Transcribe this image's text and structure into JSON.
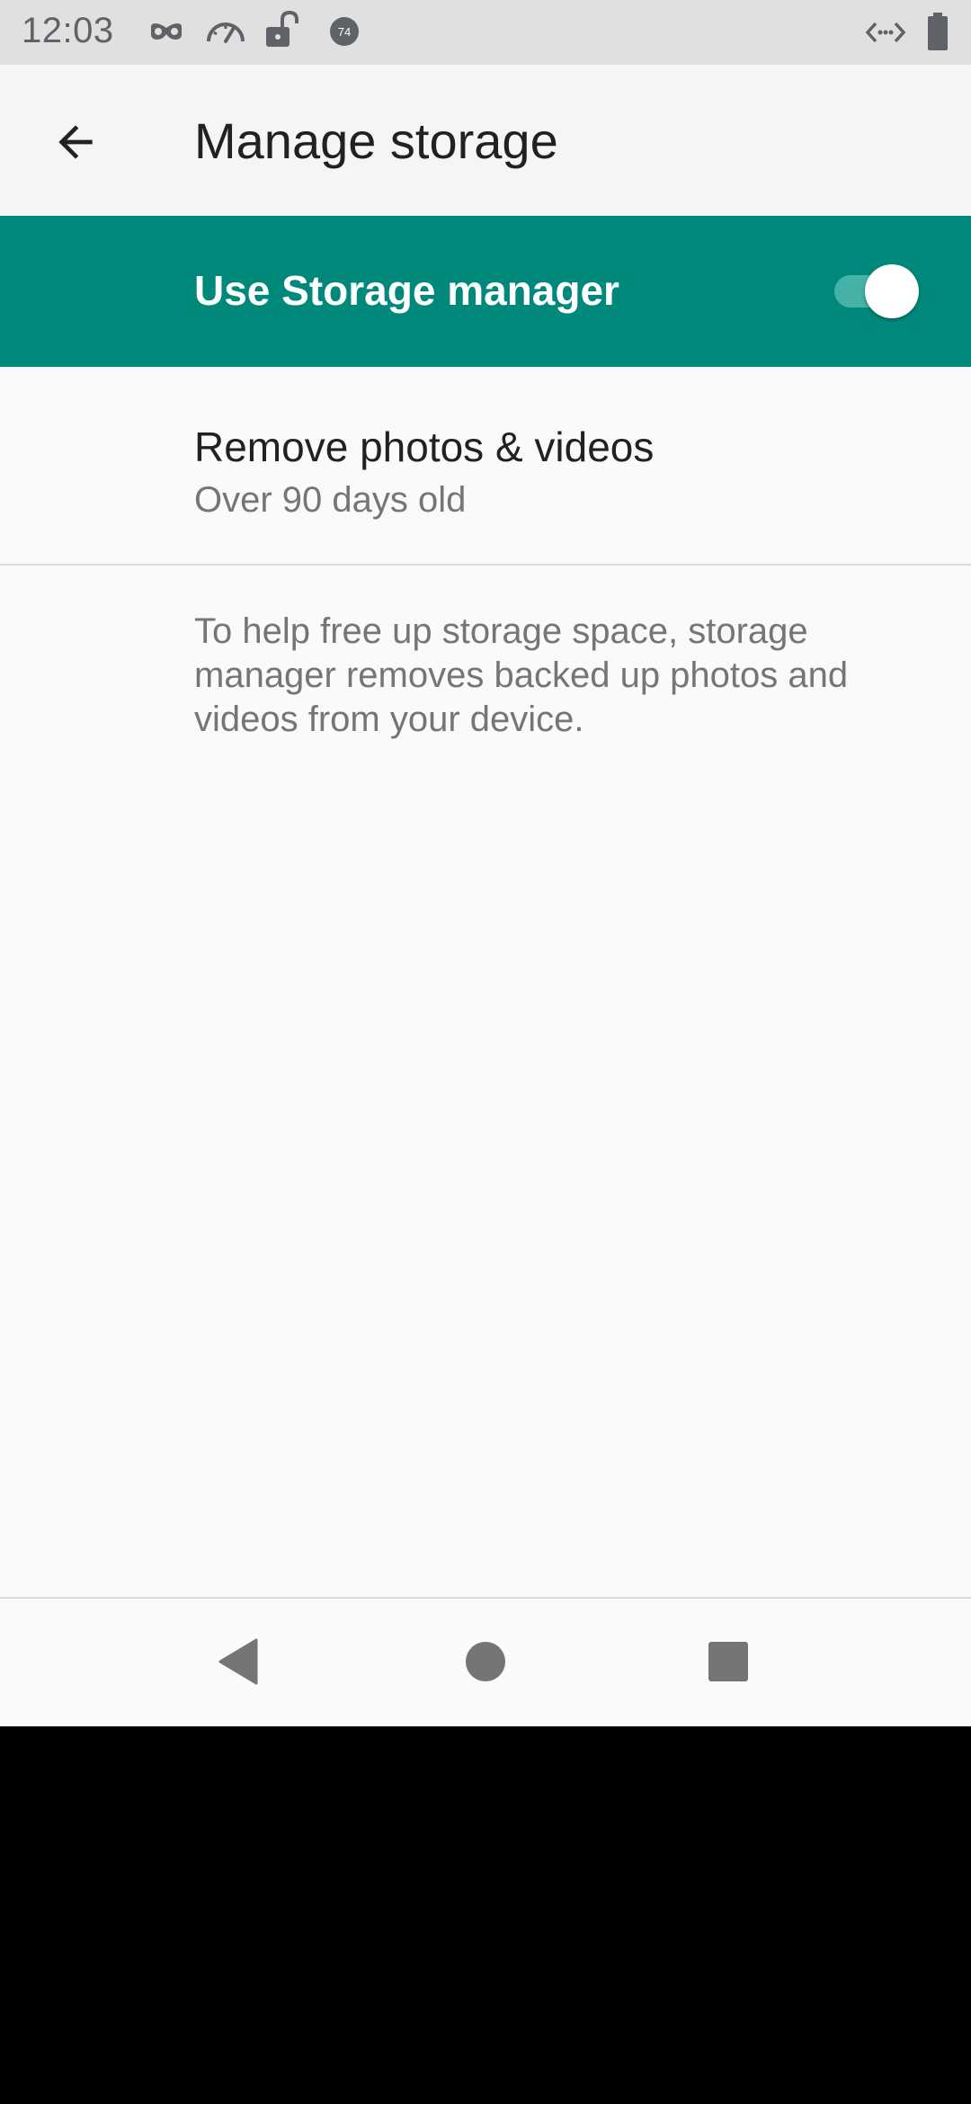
{
  "status_bar": {
    "time": "12:03",
    "icons_left": [
      "incognito-icon",
      "speedometer-icon",
      "unlocked-icon",
      "badge-74-icon"
    ],
    "badge_number": "74",
    "icons_right": [
      "code-arrows-icon",
      "battery-icon"
    ]
  },
  "app_bar": {
    "back_icon": "arrow-back-icon",
    "title": "Manage storage"
  },
  "master_switch": {
    "label": "Use Storage manager",
    "checked": true,
    "background_color": "#00897b"
  },
  "preference": {
    "title": "Remove photos & videos",
    "summary": "Over 90 days old"
  },
  "footer": {
    "text": "To help free up storage space, storage manager removes backed up photos and videos from your device."
  },
  "nav_bar": {
    "buttons": [
      "back-triangle-icon",
      "home-circle-icon",
      "recents-square-icon"
    ]
  }
}
